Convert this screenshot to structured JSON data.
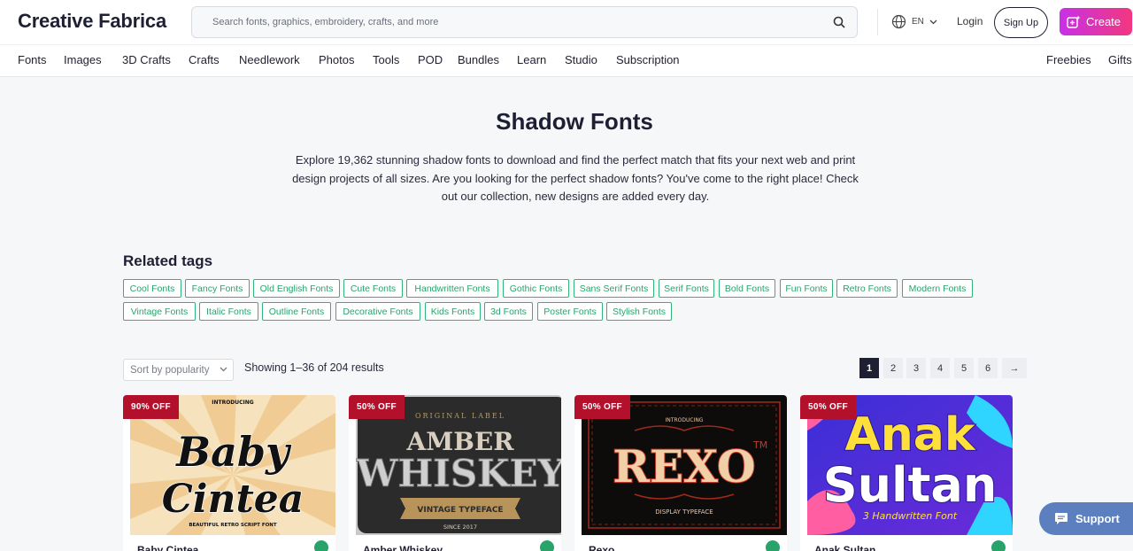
{
  "header": {
    "logo": "Creative Fabrica",
    "search_placeholder": "Search fonts, graphics, embroidery, crafts, and more",
    "lang": "EN",
    "login": "Login",
    "signup": "Sign Up",
    "create": "Create",
    "accent": "#e23bb3"
  },
  "nav": {
    "items": [
      "Fonts",
      "Images",
      "3D Crafts",
      "Crafts",
      "Needlework",
      "Photos",
      "Tools",
      "POD",
      "Bundles",
      "Learn",
      "Studio",
      "Subscription"
    ],
    "right": [
      "Freebies",
      "Gifts"
    ]
  },
  "hero": {
    "title": "Shadow Fonts",
    "description": "Explore 19,362 stunning shadow fonts to download and find the perfect match that fits your next web and print design projects of all sizes. Are you looking for the perfect shadow fonts? You've come to the right place! Check out our collection, new designs are added every day."
  },
  "tags": {
    "heading": "Related tags",
    "items": [
      "Cool Fonts",
      "Fancy Fonts",
      "Old English Fonts",
      "Cute Fonts",
      "Handwritten Fonts",
      "Gothic Fonts",
      "Sans Serif Fonts",
      "Serif Fonts",
      "Bold Fonts",
      "Fun Fonts",
      "Retro Fonts",
      "Modern Fonts",
      "Vintage Fonts",
      "Italic Fonts",
      "Outline Fonts",
      "Decorative Fonts",
      "Kids Fonts",
      "3d Fonts",
      "Poster Fonts",
      "Stylish Fonts"
    ],
    "color": "#2aa36b"
  },
  "toolbar": {
    "sort": "Sort by popularity",
    "results": "Showing 1–36 of 204 results",
    "pages": [
      "1",
      "2",
      "3",
      "4",
      "5",
      "6"
    ],
    "next": "→"
  },
  "products": [
    {
      "badge": "90% OFF",
      "name": "Baby Cintea",
      "art_title": "Baby Cintea",
      "art_top": "INTRODUCING",
      "art_sub": "BEAUTIFUL RETRO SCRIPT FONT"
    },
    {
      "badge": "50% OFF",
      "name": "Amber Whiskey",
      "art_top": "ORIGINAL LABEL",
      "art_line1": "AMBER",
      "art_line2": "WHISKEY",
      "art_sub": "VINTAGE TYPEFACE",
      "art_year": "SINCE 2017"
    },
    {
      "badge": "50% OFF",
      "name": "Rexo",
      "art_top": "INTRODUCING",
      "art_title": "REXO",
      "art_tm": "TM",
      "art_sub": "DISPLAY TYPEFACE"
    },
    {
      "badge": "50% OFF",
      "name": "Anak Sultan",
      "art_line1": "Anak",
      "art_line2": "Sultan",
      "art_sub": "3 Handwritten Font"
    }
  ],
  "support": "Support"
}
